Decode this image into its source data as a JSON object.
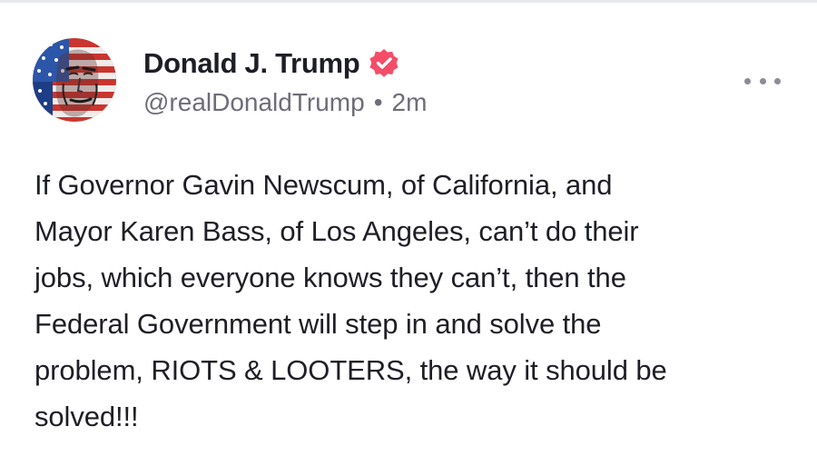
{
  "post": {
    "author": {
      "display_name": "Donald J. Trump",
      "handle": "@realDonaldTrump",
      "timestamp": "2m",
      "separator": "•",
      "verified_badge_color": "#f44d68",
      "avatar_icon": "flag-portrait-avatar"
    },
    "text_lines": [
      "If Governor Gavin Newscum, of California, and",
      "Mayor Karen Bass, of Los Angeles, can’t do their",
      "jobs, which everyone knows they can’t, then the",
      "Federal Government will step in and solve the",
      "problem, RIOTS & LOOTERS, the way it should be",
      "solved!!!"
    ],
    "more_icon": "more-options-icon"
  }
}
